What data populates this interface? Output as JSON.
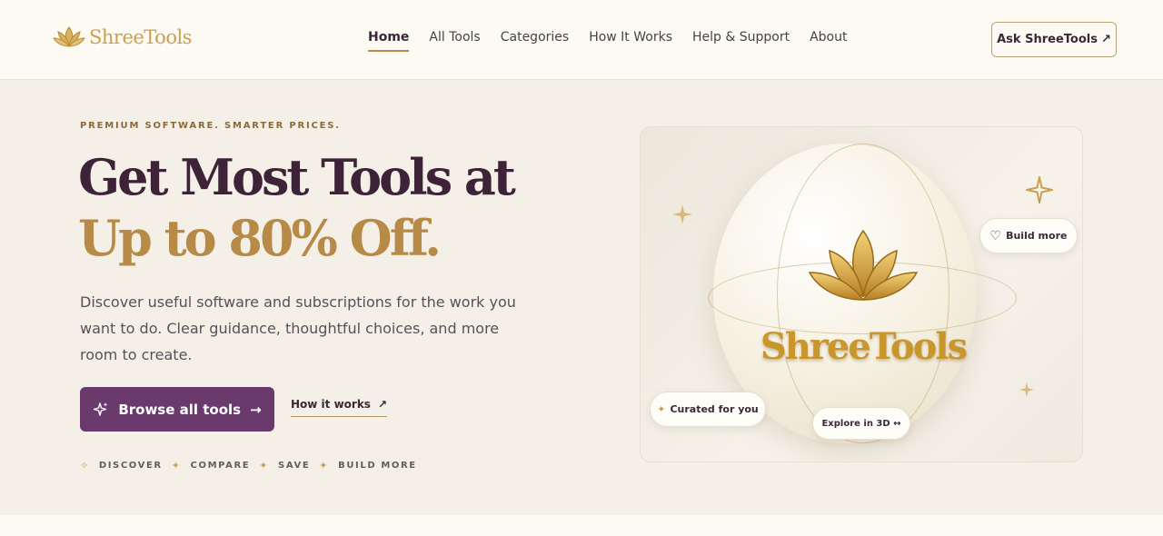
{
  "header": {
    "logo_text": "ShreeTools",
    "nav": [
      {
        "label": "Home",
        "active": true
      },
      {
        "label": "All Tools"
      },
      {
        "label": "Categories"
      },
      {
        "label": "How It Works"
      },
      {
        "label": "Help & Support"
      },
      {
        "label": "About"
      }
    ],
    "ask_button": "Ask ShreeTools"
  },
  "hero": {
    "eyebrow": "PREMIUM SOFTWARE. SMARTER PRICES.",
    "headline_line1": "Get Most Tools at",
    "headline_line2": "Up to 80% Off.",
    "description": "Discover useful software and subscriptions for the work you want to do. Clear guidance, thoughtful choices, and more room to create.",
    "browse_button": "Browse all tools",
    "how_link": "How it works",
    "steps": [
      "DISCOVER",
      "COMPARE",
      "SAVE",
      "BUILD MORE"
    ]
  },
  "panel": {
    "brand_text": "ShreeTools",
    "chip_build": "Build more",
    "chip_curated": "Curated for you",
    "chip_explore": "Explore in 3D ↔"
  },
  "colors": {
    "accent_purple": "#6a3a6c",
    "accent_gold": "#b88a48",
    "headline_dark": "#3d2238"
  }
}
